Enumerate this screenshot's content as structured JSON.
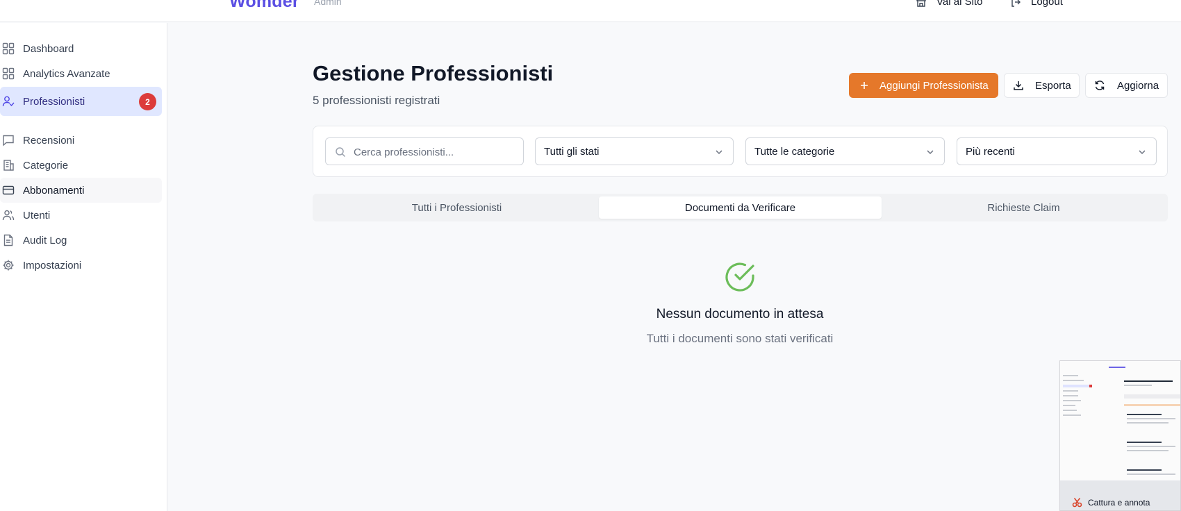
{
  "header": {
    "brand": "Womder",
    "brand_sub": "Admin",
    "links": [
      {
        "label": "Vai al Sito",
        "icon": "store-icon"
      },
      {
        "label": "Logout",
        "icon": "logout-icon"
      }
    ]
  },
  "sidebar": {
    "items": [
      {
        "label": "Dashboard",
        "icon": "grid-icon"
      },
      {
        "label": "Analytics Avanzate",
        "icon": "grid-icon"
      },
      {
        "label": "Professionisti",
        "icon": "user-check-icon",
        "badge": "2",
        "active": true
      },
      {
        "label": "Recensioni",
        "icon": "message-icon"
      },
      {
        "label": "Categorie",
        "icon": "building-icon"
      },
      {
        "label": "Abbonamenti",
        "icon": "credit-card-icon"
      },
      {
        "label": "Utenti",
        "icon": "users-icon"
      },
      {
        "label": "Audit Log",
        "icon": "file-text-icon"
      },
      {
        "label": "Impostazioni",
        "icon": "gear-icon"
      }
    ]
  },
  "main": {
    "title": "Gestione Professionisti",
    "subtitle": "5 professionisti registrati",
    "actions": {
      "add": "Aggiungi Professionista",
      "export": "Esporta",
      "refresh": "Aggiorna"
    },
    "filters": {
      "search_placeholder": "Cerca professionisti...",
      "status": "Tutti gli stati",
      "category": "Tutte le categorie",
      "sort": "Più recenti"
    },
    "tabs": [
      {
        "label": "Tutti i Professionisti"
      },
      {
        "label": "Documenti da Verificare",
        "active": true
      },
      {
        "label": "Richieste Claim"
      }
    ],
    "empty": {
      "title": "Nessun documento in attesa",
      "subtitle": "Tutti i documenti sono stati verificati"
    }
  },
  "screenshot_thumbnail": {
    "caption": "Cattura e annota"
  },
  "colors": {
    "brand": "#5b4fe3",
    "primary_button": "#e5782a",
    "active_nav": "#e0e7ff",
    "badge": "#dc3b3b",
    "success": "#6cbd5a"
  }
}
